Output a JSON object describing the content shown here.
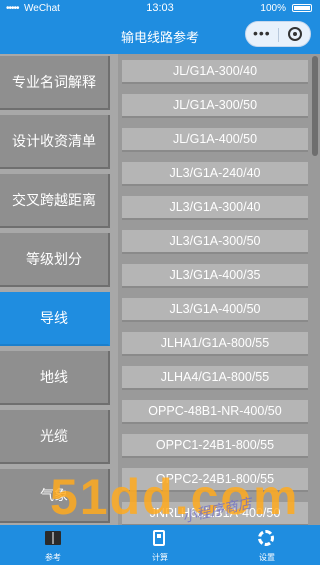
{
  "status_bar": {
    "signal": "•••••",
    "carrier": "WeChat",
    "time": "13:03",
    "battery": "100%"
  },
  "nav": {
    "title": "输电线路参考",
    "menu_glyph": "•••"
  },
  "sidebar": {
    "items": [
      {
        "label": "专业名词解释",
        "active": false
      },
      {
        "label": "设计收资清单",
        "active": false
      },
      {
        "label": "交叉跨越距离",
        "active": false
      },
      {
        "label": "等级划分",
        "active": false
      },
      {
        "label": "导线",
        "active": true
      },
      {
        "label": "地线",
        "active": false
      },
      {
        "label": "光缆",
        "active": false
      },
      {
        "label": "气象",
        "active": false
      }
    ]
  },
  "conductor_list": [
    "JL/G1A-300/40",
    "JL/G1A-300/50",
    "JL/G1A-400/50",
    "JL3/G1A-240/40",
    "JL3/G1A-300/40",
    "JL3/G1A-300/50",
    "JL3/G1A-400/35",
    "JL3/G1A-400/50",
    "JLHA1/G1A-800/55",
    "JLHA4/G1A-800/55",
    "OPPC-48B1-NR-400/50",
    "OPPC1-24B1-800/55",
    "OPPC2-24B1-800/55",
    "JNRLH60/LB1A-400/50"
  ],
  "tabbar": {
    "tabs": [
      {
        "label": "参考",
        "icon": "book-icon"
      },
      {
        "label": "计算",
        "icon": "calculator-icon"
      },
      {
        "label": "设置",
        "icon": "gear-icon"
      }
    ]
  },
  "watermark": {
    "text": "51dd.com",
    "signature": "小程序商店"
  },
  "colors": {
    "primary": "#1f8de0",
    "sidebar_item": "#8f8f8f",
    "list_row": "#b5b5b5"
  }
}
